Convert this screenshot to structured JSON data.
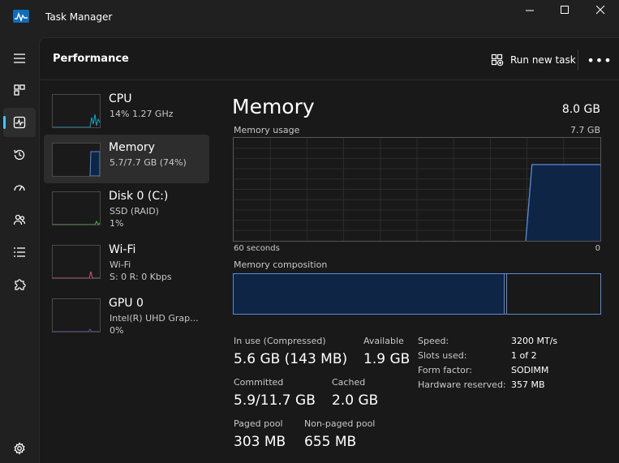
{
  "window": {
    "title": "Task Manager"
  },
  "header": {
    "title": "Performance",
    "run_new_task": "Run new task"
  },
  "nav": {
    "items": [
      "hamburger-menu",
      "processes",
      "performance",
      "app-history",
      "startup-apps",
      "users",
      "details",
      "services"
    ],
    "active": "performance",
    "settings": "settings"
  },
  "devices": [
    {
      "name": "CPU",
      "sub1": "14%  1.27 GHz",
      "sub2": ""
    },
    {
      "name": "Memory",
      "sub1": "5.7/7.7 GB (74%)",
      "sub2": ""
    },
    {
      "name": "Disk 0 (C:)",
      "sub1": "SSD (RAID)",
      "sub2": "1%"
    },
    {
      "name": "Wi-Fi",
      "sub1": "Wi-Fi",
      "sub2": "S: 0 R: 0 Kbps"
    },
    {
      "name": "GPU 0",
      "sub1": "Intel(R) UHD Grap...",
      "sub2": "0%"
    }
  ],
  "memory": {
    "title": "Memory",
    "total": "8.0 GB",
    "usage_label": "Memory usage",
    "usage_max": "7.7 GB",
    "axis_left": "60 seconds",
    "axis_right": "0",
    "composition_label": "Memory composition",
    "composition": {
      "in_use_fraction": 0.74,
      "modified_fraction": 0.006
    },
    "usage_history_percent": [
      0,
      0,
      0,
      0,
      0,
      0,
      0,
      0,
      0,
      0,
      0,
      0,
      0,
      0,
      0,
      0,
      0,
      0,
      0,
      0,
      0,
      0,
      0,
      0,
      0,
      0,
      0,
      0,
      0,
      0,
      0,
      0,
      0,
      0,
      0,
      0,
      0,
      0,
      0,
      0,
      0,
      0,
      0,
      0,
      0,
      0,
      0,
      0,
      74,
      74,
      74,
      74,
      74,
      74,
      74,
      74,
      74,
      74,
      74,
      74
    ],
    "stats": {
      "in_use_label": "In use (Compressed)",
      "in_use_value": "5.6 GB (143 MB)",
      "available_label": "Available",
      "available_value": "1.9 GB",
      "committed_label": "Committed",
      "committed_value": "5.9/11.7 GB",
      "cached_label": "Cached",
      "cached_value": "2.0 GB",
      "paged_label": "Paged pool",
      "paged_value": "303 MB",
      "nonpaged_label": "Non-paged pool",
      "nonpaged_value": "655 MB"
    },
    "specs": [
      {
        "label": "Speed:",
        "value": "3200 MT/s"
      },
      {
        "label": "Slots used:",
        "value": "1 of 2"
      },
      {
        "label": "Form factor:",
        "value": "SODIMM"
      },
      {
        "label": "Hardware reserved:",
        "value": "357 MB"
      }
    ]
  },
  "colors": {
    "accent": "#4cc2ff",
    "memory_line": "#5a8ad6",
    "memory_fill": "#0f2546",
    "cpu_line": "#17a2c6",
    "disk_line": "#4caf50",
    "wifi_line": "#d6568c",
    "gpu_line": "#6a4fb5"
  }
}
